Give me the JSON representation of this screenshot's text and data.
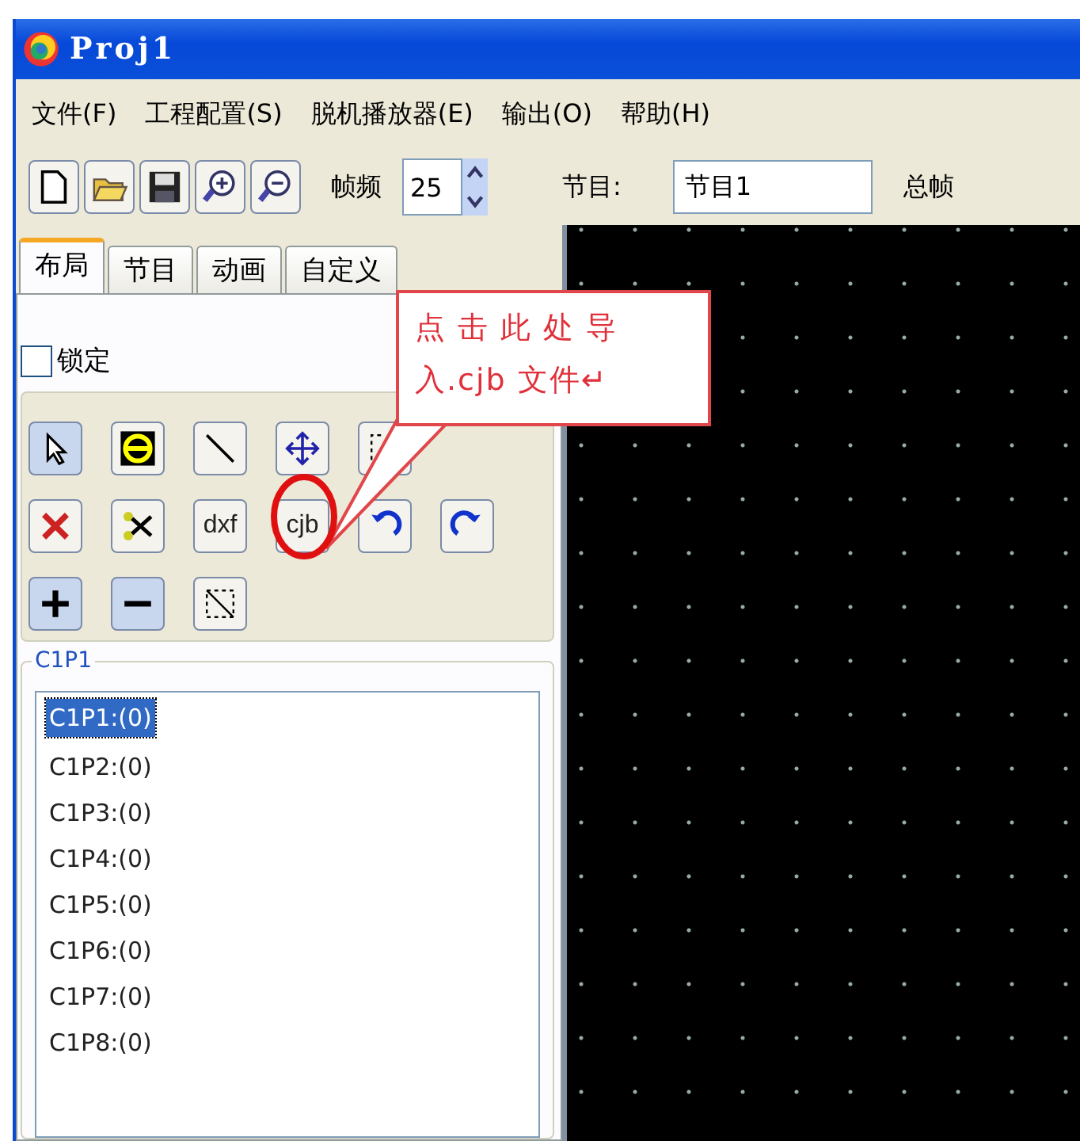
{
  "window": {
    "title": "Proj1"
  },
  "menu": [
    "文件(F)",
    "工程配置(S)",
    "脱机播放器(E)",
    "输出(O)",
    "帮助(H)"
  ],
  "toolbar": {
    "frame_rate_label": "帧频",
    "frame_rate": "25",
    "program_label": "节目:",
    "program": "节目1",
    "total_label": "总帧"
  },
  "tabs": [
    {
      "label": "布局",
      "selected": true
    },
    {
      "label": "节目",
      "selected": false
    },
    {
      "label": "动画",
      "selected": false
    },
    {
      "label": "自定义",
      "selected": false
    }
  ],
  "lock": {
    "label": "锁定",
    "checked": false
  },
  "tool_labels": [
    "dxf",
    "cjb"
  ],
  "group": {
    "title": "C1P1"
  },
  "list": [
    {
      "label": "C1P1:(0)",
      "selected": true
    },
    {
      "label": "C1P2:(0)",
      "selected": false
    },
    {
      "label": "C1P3:(0)",
      "selected": false
    },
    {
      "label": "C1P4:(0)",
      "selected": false
    },
    {
      "label": "C1P5:(0)",
      "selected": false
    },
    {
      "label": "C1P6:(0)",
      "selected": false
    },
    {
      "label": "C1P7:(0)",
      "selected": false
    },
    {
      "label": "C1P8:(0)",
      "selected": false
    }
  ],
  "callout": {
    "lines": [
      "点 击 此 处 导",
      "入.cjb 文件↵"
    ]
  }
}
